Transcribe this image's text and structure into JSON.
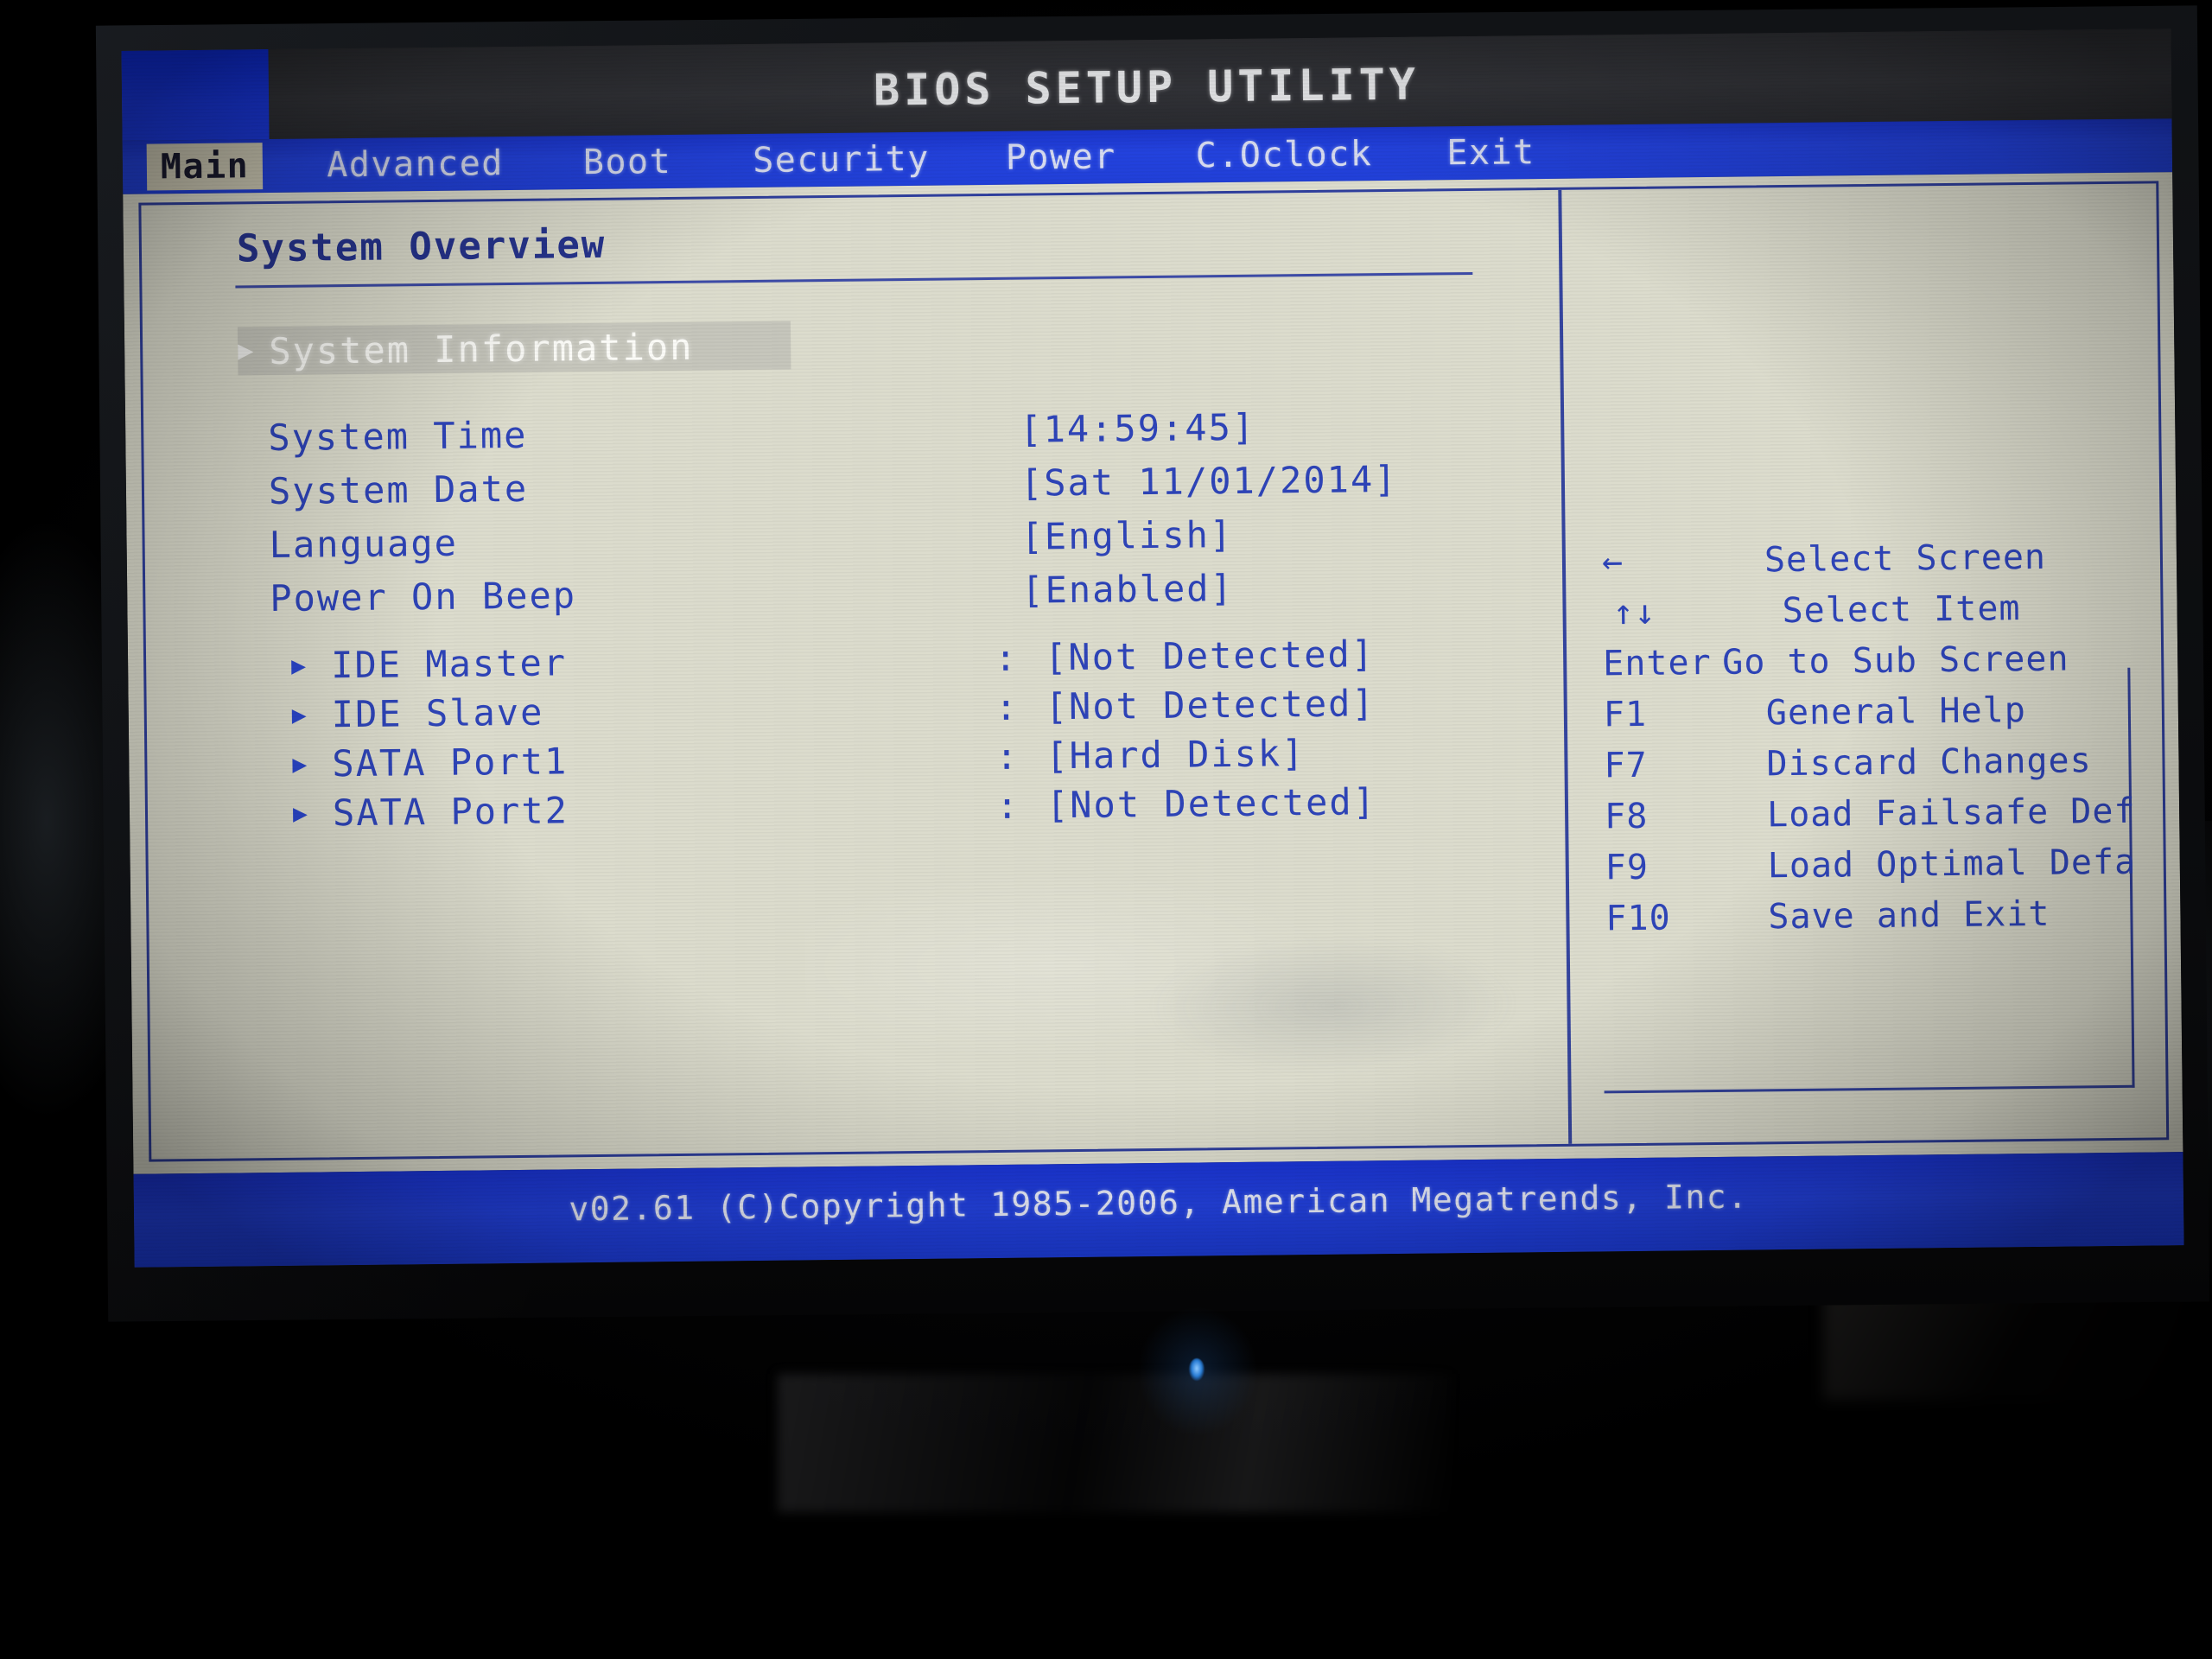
{
  "title": "BIOS SETUP UTILITY",
  "menu": {
    "items": [
      {
        "label": "Main",
        "active": true
      },
      {
        "label": "Advanced",
        "active": false
      },
      {
        "label": "Boot",
        "active": false
      },
      {
        "label": "Security",
        "active": false
      },
      {
        "label": "Power",
        "active": false
      },
      {
        "label": "C.Oclock",
        "active": false
      },
      {
        "label": "Exit",
        "active": false
      }
    ]
  },
  "main": {
    "section_title": "System Overview",
    "submenu": {
      "arrow": "▶",
      "label": "System Information"
    },
    "settings": [
      {
        "key": "System Time",
        "value": "[14:59:45]"
      },
      {
        "key": "System Date",
        "value": "[Sat 11/01/2014]"
      },
      {
        "key": "Language",
        "value": "[English]"
      },
      {
        "key": "Power On Beep",
        "value": "[Enabled]"
      }
    ],
    "drives": [
      {
        "arrow": "▶",
        "key": "IDE Master",
        "colon": ":",
        "value": "[Not Detected]"
      },
      {
        "arrow": "▶",
        "key": "IDE Slave",
        "colon": ":",
        "value": "[Not Detected]"
      },
      {
        "arrow": "▶",
        "key": "SATA Port1",
        "colon": ":",
        "value": "[Hard Disk]"
      },
      {
        "arrow": "▶",
        "key": "SATA Port2",
        "colon": ":",
        "value": "[Not Detected]"
      }
    ]
  },
  "help": {
    "keys": [
      {
        "key": "←",
        "desc": "Select Screen",
        "indent": "ind-1"
      },
      {
        "key": "↑↓",
        "desc": "Select Item",
        "indent": "ind-2"
      },
      {
        "key": "Enter",
        "desc": "Go to Sub Screen",
        "indent": ""
      },
      {
        "key": "F1",
        "desc": "General Help",
        "indent": "ind-1"
      },
      {
        "key": "F7",
        "desc": "Discard Changes",
        "indent": "ind-1"
      },
      {
        "key": "F8",
        "desc": "Load Failsafe Def",
        "indent": "ind-1"
      },
      {
        "key": "F9",
        "desc": "Load Optimal Defa",
        "indent": "ind-1"
      },
      {
        "key": "F10",
        "desc": "Save and Exit",
        "indent": "ind-1"
      }
    ]
  },
  "footer": {
    "text": "v02.61 (C)Copyright 1985-2006, American Megatrends, Inc."
  },
  "colors": {
    "menu_blue": "#2140d8",
    "body_beige": "#dcdccd",
    "text_blue": "#2e44b8",
    "border_blue": "#33429d",
    "active_tab_bg": "#cfcbb6"
  }
}
